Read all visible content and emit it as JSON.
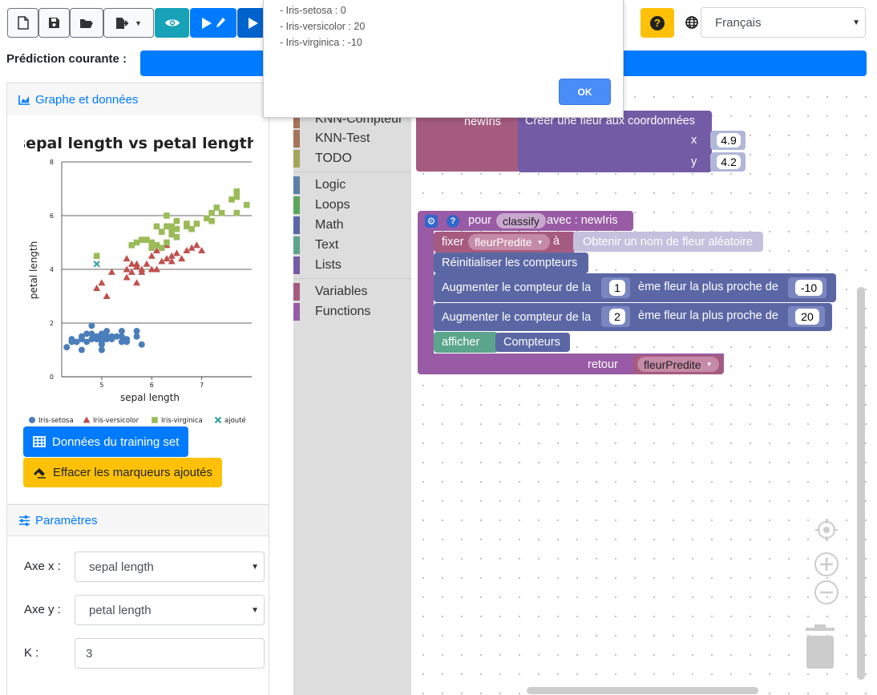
{
  "toolbar": {
    "lang_value": "Français",
    "help_label": "?"
  },
  "prediction": {
    "label": "Prédiction courante :"
  },
  "graph_panel": {
    "title": "Graphe et données",
    "training_button": "Données du training set",
    "clear_button": "Effacer les marqueurs ajoutés"
  },
  "params_panel": {
    "title": "Paramètres",
    "x_label": "Axe x :",
    "x_value": "sepal length",
    "y_label": "Axe y :",
    "y_value": "petal length",
    "k_label": "K :",
    "k_value": "3"
  },
  "toolbox": {
    "items": [
      {
        "label": "KNN-Compteur",
        "color": "#a5745b"
      },
      {
        "label": "KNN-Test",
        "color": "#a5745b"
      },
      {
        "label": "TODO",
        "color": "#a5a55b"
      },
      {
        "label": "Logic",
        "color": "#5b80a5"
      },
      {
        "label": "Loops",
        "color": "#5ba55b"
      },
      {
        "label": "Math",
        "color": "#5b67a5"
      },
      {
        "label": "Text",
        "color": "#5ba58c"
      },
      {
        "label": "Lists",
        "color": "#745ba5"
      },
      {
        "label": "Variables",
        "color": "#a55b80"
      },
      {
        "label": "Functions",
        "color": "#995ba5"
      }
    ]
  },
  "blocks": {
    "newiris_var": "newIris",
    "create_flower": "Créer une fleur aux coordonnées",
    "x_label": "x",
    "x_value": "4.9",
    "y_label": "y",
    "y_value": "4.2",
    "func_pour": "pour",
    "func_name": "classify",
    "func_avec": "avec : newIris",
    "fixer": "fixer",
    "fixer_var": "fleurPredite",
    "fixer_a": "à",
    "random_name": "Obtenir un nom de fleur aléatoire",
    "reset": "Réinitialiser les compteurs",
    "inc_prefix": "Augmenter le compteur de la",
    "inc_mid": "ème fleur la plus proche de",
    "inc1_n": "1",
    "inc1_v": "-10",
    "inc2_n": "2",
    "inc2_v": "20",
    "afficher": "afficher",
    "compteurs": "Compteurs",
    "retour": "retour",
    "retour_var": "fleurPredite"
  },
  "dialog": {
    "lines": [
      "- Iris-setosa : 0",
      "- Iris-versicolor : 20",
      "- Iris-virginica : -10"
    ],
    "ok": "OK"
  },
  "chart_data": {
    "type": "scatter",
    "title": "sepal length vs petal length",
    "xlabel": "sepal length",
    "ylabel": "petal length",
    "xlim": [
      4.2,
      8.0
    ],
    "ylim": [
      0,
      8
    ],
    "xticks": [
      5,
      6,
      7
    ],
    "yticks": [
      0,
      2,
      4,
      6,
      8
    ],
    "grid": "y-major",
    "legend_position": "bottom",
    "series": [
      {
        "name": "Iris-setosa",
        "marker": "circle",
        "color": "#4a7ebb",
        "points": [
          [
            4.3,
            1.1
          ],
          [
            4.4,
            1.3
          ],
          [
            4.4,
            1.4
          ],
          [
            4.5,
            1.3
          ],
          [
            4.6,
            1.4
          ],
          [
            4.6,
            1.5
          ],
          [
            4.7,
            1.3
          ],
          [
            4.7,
            1.6
          ],
          [
            4.8,
            1.4
          ],
          [
            4.8,
            1.6
          ],
          [
            4.8,
            1.9
          ],
          [
            4.9,
            1.4
          ],
          [
            4.9,
            1.5
          ],
          [
            5.0,
            1.2
          ],
          [
            5.0,
            1.3
          ],
          [
            5.0,
            1.4
          ],
          [
            5.0,
            1.6
          ],
          [
            5.1,
            1.4
          ],
          [
            5.1,
            1.5
          ],
          [
            5.1,
            1.7
          ],
          [
            5.2,
            1.4
          ],
          [
            5.2,
            1.5
          ],
          [
            5.3,
            1.5
          ],
          [
            5.4,
            1.3
          ],
          [
            5.4,
            1.5
          ],
          [
            5.4,
            1.7
          ],
          [
            5.5,
            1.3
          ],
          [
            5.5,
            1.4
          ],
          [
            5.7,
            1.5
          ],
          [
            5.7,
            1.7
          ],
          [
            5.8,
            1.2
          ],
          [
            4.6,
            1.0
          ],
          [
            5.0,
            1.0
          ]
        ]
      },
      {
        "name": "Iris-versicolor",
        "marker": "triangle",
        "color": "#c0504d",
        "points": [
          [
            4.9,
            3.3
          ],
          [
            5.0,
            3.5
          ],
          [
            5.1,
            3.0
          ],
          [
            5.2,
            3.9
          ],
          [
            5.5,
            4.0
          ],
          [
            5.5,
            3.7
          ],
          [
            5.6,
            3.9
          ],
          [
            5.6,
            4.2
          ],
          [
            5.7,
            3.5
          ],
          [
            5.7,
            4.1
          ],
          [
            5.8,
            3.9
          ],
          [
            5.8,
            4.0
          ],
          [
            5.9,
            4.2
          ],
          [
            6.0,
            4.0
          ],
          [
            6.0,
            4.5
          ],
          [
            6.1,
            4.0
          ],
          [
            6.1,
            4.7
          ],
          [
            6.2,
            4.3
          ],
          [
            6.3,
            4.4
          ],
          [
            6.3,
            4.9
          ],
          [
            6.4,
            4.3
          ],
          [
            6.5,
            4.6
          ],
          [
            6.6,
            4.4
          ],
          [
            6.7,
            4.7
          ],
          [
            6.8,
            4.8
          ],
          [
            6.9,
            4.9
          ],
          [
            7.0,
            4.7
          ],
          [
            6.4,
            4.5
          ],
          [
            5.5,
            4.4
          ],
          [
            5.7,
            4.2
          ]
        ]
      },
      {
        "name": "Iris-virginica",
        "marker": "square",
        "color": "#9bbb59",
        "points": [
          [
            4.9,
            4.5
          ],
          [
            5.6,
            4.9
          ],
          [
            5.7,
            5.0
          ],
          [
            5.8,
            5.1
          ],
          [
            5.9,
            5.1
          ],
          [
            6.0,
            4.8
          ],
          [
            6.0,
            5.0
          ],
          [
            6.1,
            4.9
          ],
          [
            6.2,
            4.8
          ],
          [
            6.2,
            5.4
          ],
          [
            6.3,
            5.0
          ],
          [
            6.3,
            5.6
          ],
          [
            6.3,
            6.0
          ],
          [
            6.4,
            5.3
          ],
          [
            6.4,
            5.5
          ],
          [
            6.5,
            5.2
          ],
          [
            6.5,
            5.8
          ],
          [
            6.7,
            5.6
          ],
          [
            6.7,
            5.7
          ],
          [
            6.8,
            5.5
          ],
          [
            6.9,
            5.7
          ],
          [
            7.1,
            5.9
          ],
          [
            7.2,
            5.8
          ],
          [
            7.2,
            6.1
          ],
          [
            7.3,
            6.3
          ],
          [
            7.4,
            6.1
          ],
          [
            7.6,
            6.6
          ],
          [
            7.7,
            6.7
          ],
          [
            7.7,
            6.9
          ],
          [
            7.7,
            6.1
          ],
          [
            7.9,
            6.4
          ],
          [
            6.1,
            5.6
          ],
          [
            6.4,
            5.6
          ],
          [
            6.5,
            5.5
          ]
        ]
      },
      {
        "name": "ajouté",
        "marker": "x",
        "color": "#2aa198",
        "points": [
          [
            4.9,
            4.2
          ]
        ]
      }
    ]
  }
}
